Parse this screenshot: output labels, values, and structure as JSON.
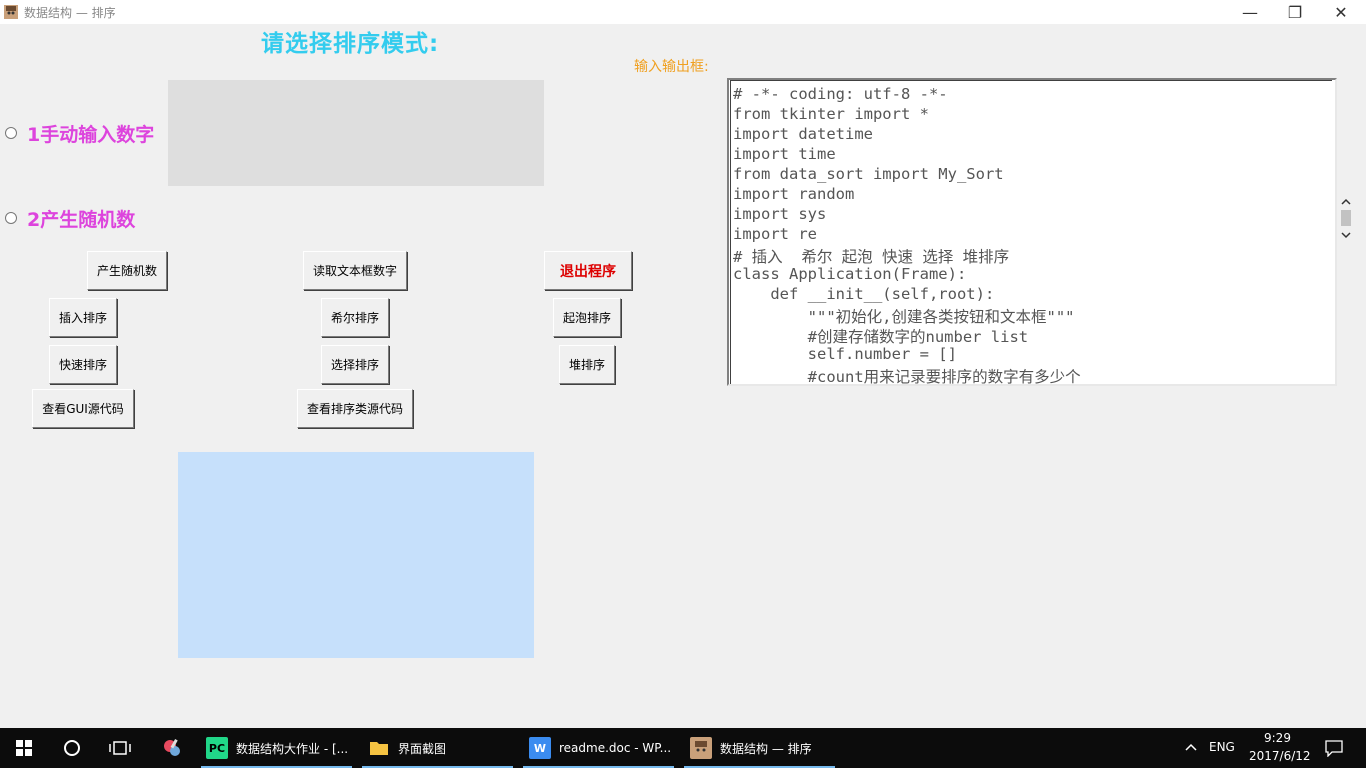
{
  "window": {
    "title": "数据结构 — 排序",
    "minimize_glyph": "—",
    "restore_glyph": "❐",
    "close_glyph": "✕"
  },
  "heading": "请选择排序模式:",
  "io_label": "输入输出框:",
  "options": {
    "manual_label": "1手动输入数字",
    "random_label": "2产生随机数"
  },
  "buttons": {
    "generate_random": "产生随机数",
    "read_textbox": "读取文本框数字",
    "exit": "退出程序",
    "insertion_sort": "插入排序",
    "shell_sort": "希尔排序",
    "bubble_sort": "起泡排序",
    "quick_sort": "快速排序",
    "selection_sort": "选择排序",
    "heap_sort": "堆排序",
    "view_gui_source": "查看GUI源代码",
    "view_sort_source": "查看排序类源代码"
  },
  "code_lines": [
    "# -*- coding: utf-8 -*-",
    "from tkinter import *",
    "import datetime",
    "import time",
    "from data_sort import My_Sort",
    "import random",
    "import sys",
    "import re",
    "# 插入  希尔 起泡 快速 选择 堆排序",
    "class Application(Frame):",
    "    def __init__(self,root):",
    "        \"\"\"初始化,创建各类按钮和文本框\"\"\"",
    "        #创建存储数字的number list",
    "        self.number = []",
    "        #count用来记录要排序的数字有多少个"
  ],
  "taskbar": {
    "apps": [
      {
        "label": "数据结构大作业 - [...",
        "icon": "pycharm-icon"
      },
      {
        "label": "界面截图",
        "icon": "folder-icon"
      },
      {
        "label": "readme.doc - WP...",
        "icon": "wps-icon"
      },
      {
        "label": "数据结构 — 排序",
        "icon": "tk-app-icon"
      }
    ],
    "tray_lang": "ENG",
    "time": "9:29",
    "date": "2017/6/12"
  },
  "colors": {
    "heading": "#33ccee",
    "radio_label": "#dd44dd",
    "io_label": "#f0a020",
    "exit_text": "#dd0000",
    "blue_panel": "#c6e0fb"
  }
}
